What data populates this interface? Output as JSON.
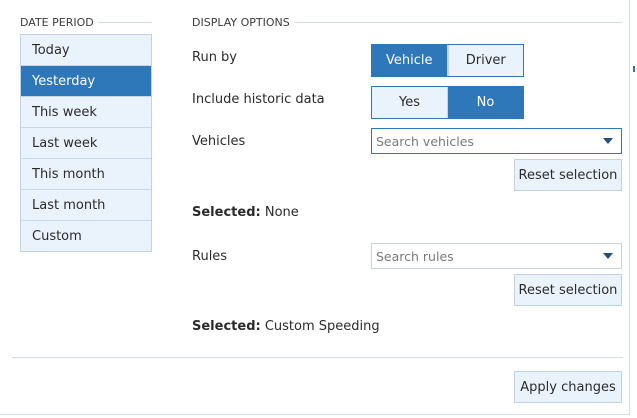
{
  "date_period": {
    "heading": "DATE PERIOD",
    "items": [
      {
        "label": "Today",
        "active": false
      },
      {
        "label": "Yesterday",
        "active": true
      },
      {
        "label": "This week",
        "active": false
      },
      {
        "label": "Last week",
        "active": false
      },
      {
        "label": "This month",
        "active": false
      },
      {
        "label": "Last month",
        "active": false
      },
      {
        "label": "Custom",
        "active": false
      }
    ]
  },
  "display_options": {
    "heading": "DISPLAY OPTIONS",
    "run_by": {
      "label": "Run by",
      "options": [
        "Vehicle",
        "Driver"
      ],
      "selected": "Vehicle"
    },
    "historic": {
      "label": "Include historic data",
      "options": [
        "Yes",
        "No"
      ],
      "selected": "No"
    },
    "vehicles": {
      "label": "Vehicles",
      "placeholder": "Search vehicles",
      "value": "",
      "reset_label": "Reset selection",
      "selected_label": "Selected:",
      "selected_value": "None"
    },
    "rules": {
      "label": "Rules",
      "placeholder": "Search rules",
      "value": "",
      "reset_label": "Reset selection",
      "selected_label": "Selected:",
      "selected_value": "Custom Speeding"
    }
  },
  "footer": {
    "apply_label": "Apply changes"
  },
  "colors": {
    "accent": "#2e77b8",
    "option_bg": "#eaf3fc",
    "border": "#bcd3e8"
  }
}
